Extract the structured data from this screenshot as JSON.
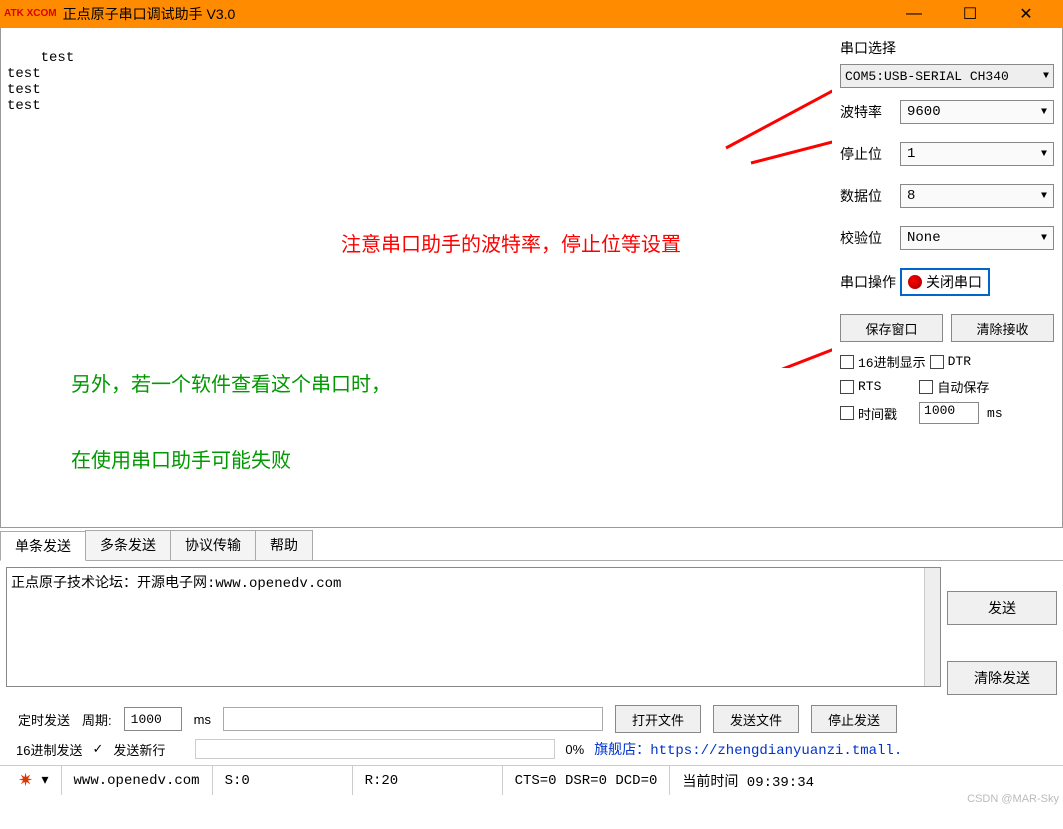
{
  "window": {
    "logo": "ATK\nXCOM",
    "title": "正点原子串口调试助手 V3.0",
    "min": "—",
    "max": "☐",
    "close": "✕"
  },
  "recv": {
    "lines": "test\ntest\ntest\ntest"
  },
  "side": {
    "port_section": "串口选择",
    "port_value": "COM5:USB-SERIAL CH340",
    "baud_label": "波特率",
    "baud_value": "9600",
    "stop_label": "停止位",
    "stop_value": "1",
    "data_label": "数据位",
    "data_value": "8",
    "parity_label": "校验位",
    "parity_value": "None",
    "op_label": "串口操作",
    "op_btn": "关闭串口",
    "save_btn": "保存窗口",
    "clear_btn": "清除接收",
    "hex_disp": "16进制显示",
    "dtr": "DTR",
    "rts": "RTS",
    "autosave": "自动保存",
    "timestamp": "时间戳",
    "interval_value": "1000",
    "interval_unit": "ms"
  },
  "annot": {
    "red": "注意串口助手的波特率，停止位等设置",
    "green_l1": "另外，若一个软件查看这个串口时，",
    "green_l2": "在使用串口助手可能失败"
  },
  "tabs": [
    "单条发送",
    "多条发送",
    "协议传输",
    "帮助"
  ],
  "send": {
    "text": "正点原子技术论坛：开源电子网:www.openedv.com",
    "send_btn": "发送",
    "clear_btn": "清除发送"
  },
  "opts": {
    "timed": "定时发送",
    "period_lbl": "周期:",
    "period_val": "1000",
    "period_unit": "ms",
    "open_file": "打开文件",
    "send_file": "发送文件",
    "stop_send": "停止发送",
    "hex_send": "16进制发送",
    "send_newline": "发送新行",
    "pct": "0%",
    "shop_label": "旗舰店：",
    "shop_url": "https://zhengdianyuanzi.tmall."
  },
  "status": {
    "gear_dd": "▾",
    "url": "www.openedv.com",
    "s": "S:0",
    "r": "R:20",
    "cts": "CTS=0 DSR=0 DCD=0",
    "time_lbl": "当前时间 09:39:34"
  },
  "watermark": "CSDN @MAR-Sky"
}
